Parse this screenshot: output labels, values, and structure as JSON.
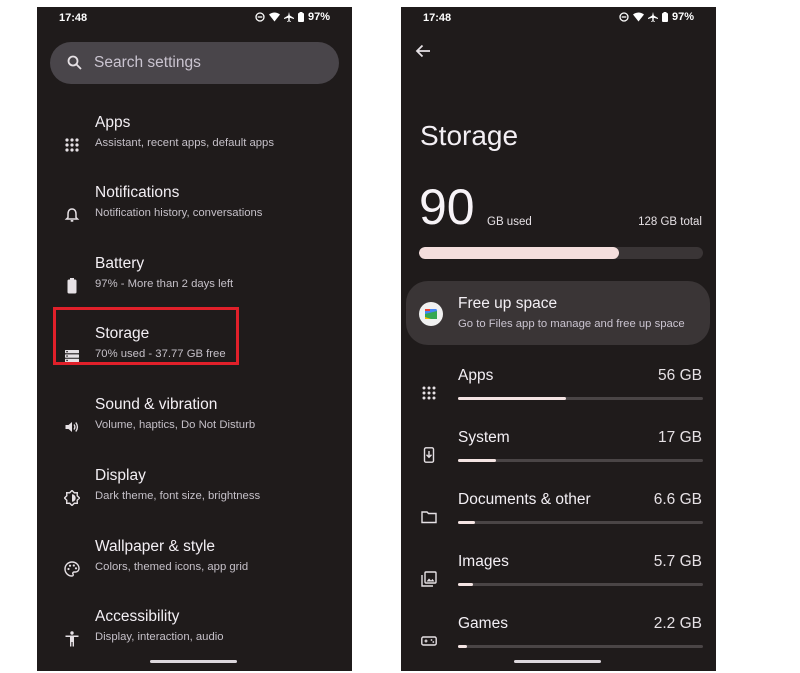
{
  "left_screen": {
    "status": {
      "time": "17:48",
      "battery": "97%"
    },
    "search": {
      "placeholder": "Search settings"
    },
    "items": [
      {
        "title": "Apps",
        "subtitle": "Assistant, recent apps, default apps",
        "icon": "apps-grid-icon"
      },
      {
        "title": "Notifications",
        "subtitle": "Notification history, conversations",
        "icon": "bell-icon"
      },
      {
        "title": "Battery",
        "subtitle": "97% - More than 2 days left",
        "icon": "battery-icon"
      },
      {
        "title": "Storage",
        "subtitle": "70% used - 37.77 GB free",
        "icon": "storage-icon"
      },
      {
        "title": "Sound & vibration",
        "subtitle": "Volume, haptics, Do Not Disturb",
        "icon": "volume-icon"
      },
      {
        "title": "Display",
        "subtitle": "Dark theme, font size, brightness",
        "icon": "brightness-icon"
      },
      {
        "title": "Wallpaper & style",
        "subtitle": "Colors, themed icons, app grid",
        "icon": "palette-icon"
      },
      {
        "title": "Accessibility",
        "subtitle": "Display, interaction, audio",
        "icon": "accessibility-icon"
      }
    ],
    "highlight_color": "#e0202a"
  },
  "right_screen": {
    "status": {
      "time": "17:48",
      "battery": "97%"
    },
    "title": "Storage",
    "used_value": "90",
    "used_unit": "GB used",
    "total": "128 GB total",
    "used_fraction": 0.703,
    "free_up": {
      "title": "Free up space",
      "subtitle": "Go to Files app to manage and free up space"
    },
    "categories": [
      {
        "name": "Apps",
        "size": "56 GB",
        "fraction": 0.44,
        "icon": "apps-grid-icon"
      },
      {
        "name": "System",
        "size": "17 GB",
        "fraction": 0.155,
        "icon": "system-update-icon"
      },
      {
        "name": "Documents & other",
        "size": "6.6 GB",
        "fraction": 0.07,
        "icon": "folder-icon"
      },
      {
        "name": "Images",
        "size": "5.7 GB",
        "fraction": 0.06,
        "icon": "image-icon"
      },
      {
        "name": "Games",
        "size": "2.2 GB",
        "fraction": 0.035,
        "icon": "gamepad-icon"
      }
    ]
  },
  "colors": {
    "background": "#1f1b1b",
    "surface": "#3a3536",
    "progress_fill": "#f4dedd",
    "text": "#f3eff4"
  }
}
